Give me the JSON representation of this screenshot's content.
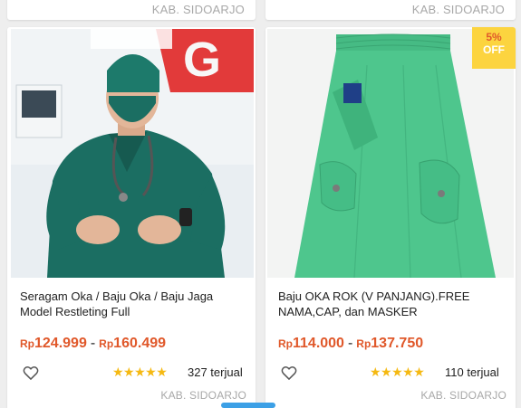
{
  "top_cards": {
    "left_location": "KAB. SIDOARJO",
    "right_location": "KAB. SIDOARJO"
  },
  "products": [
    {
      "title_line1": "Seragam Oka / Baju Oka / Baju Jaga",
      "title_line2": "Model Restleting Full",
      "currency": "Rp",
      "price_min": "124.999",
      "price_max": "160.499",
      "separator": "-",
      "stars": "★★★★★",
      "sold": "327 terjual",
      "location": "KAB. SIDOARJO"
    },
    {
      "title_line1": "Baju OKA ROK (V PANJANG).FREE",
      "title_line2": "NAMA,CAP, dan MASKER",
      "currency": "Rp",
      "price_min": "114.000",
      "price_max": "137.750",
      "separator": "-",
      "stars": "★★★★★",
      "sold": "110 terjual",
      "location": "KAB. SIDOARJO",
      "discount_percent": "5%",
      "discount_label": "OFF"
    }
  ],
  "colors": {
    "price": "#e0582a",
    "star": "#f5b912",
    "badge": "#fcd43f",
    "scrub_green": "#1b6e62",
    "skirt_green": "#4ec68d"
  }
}
